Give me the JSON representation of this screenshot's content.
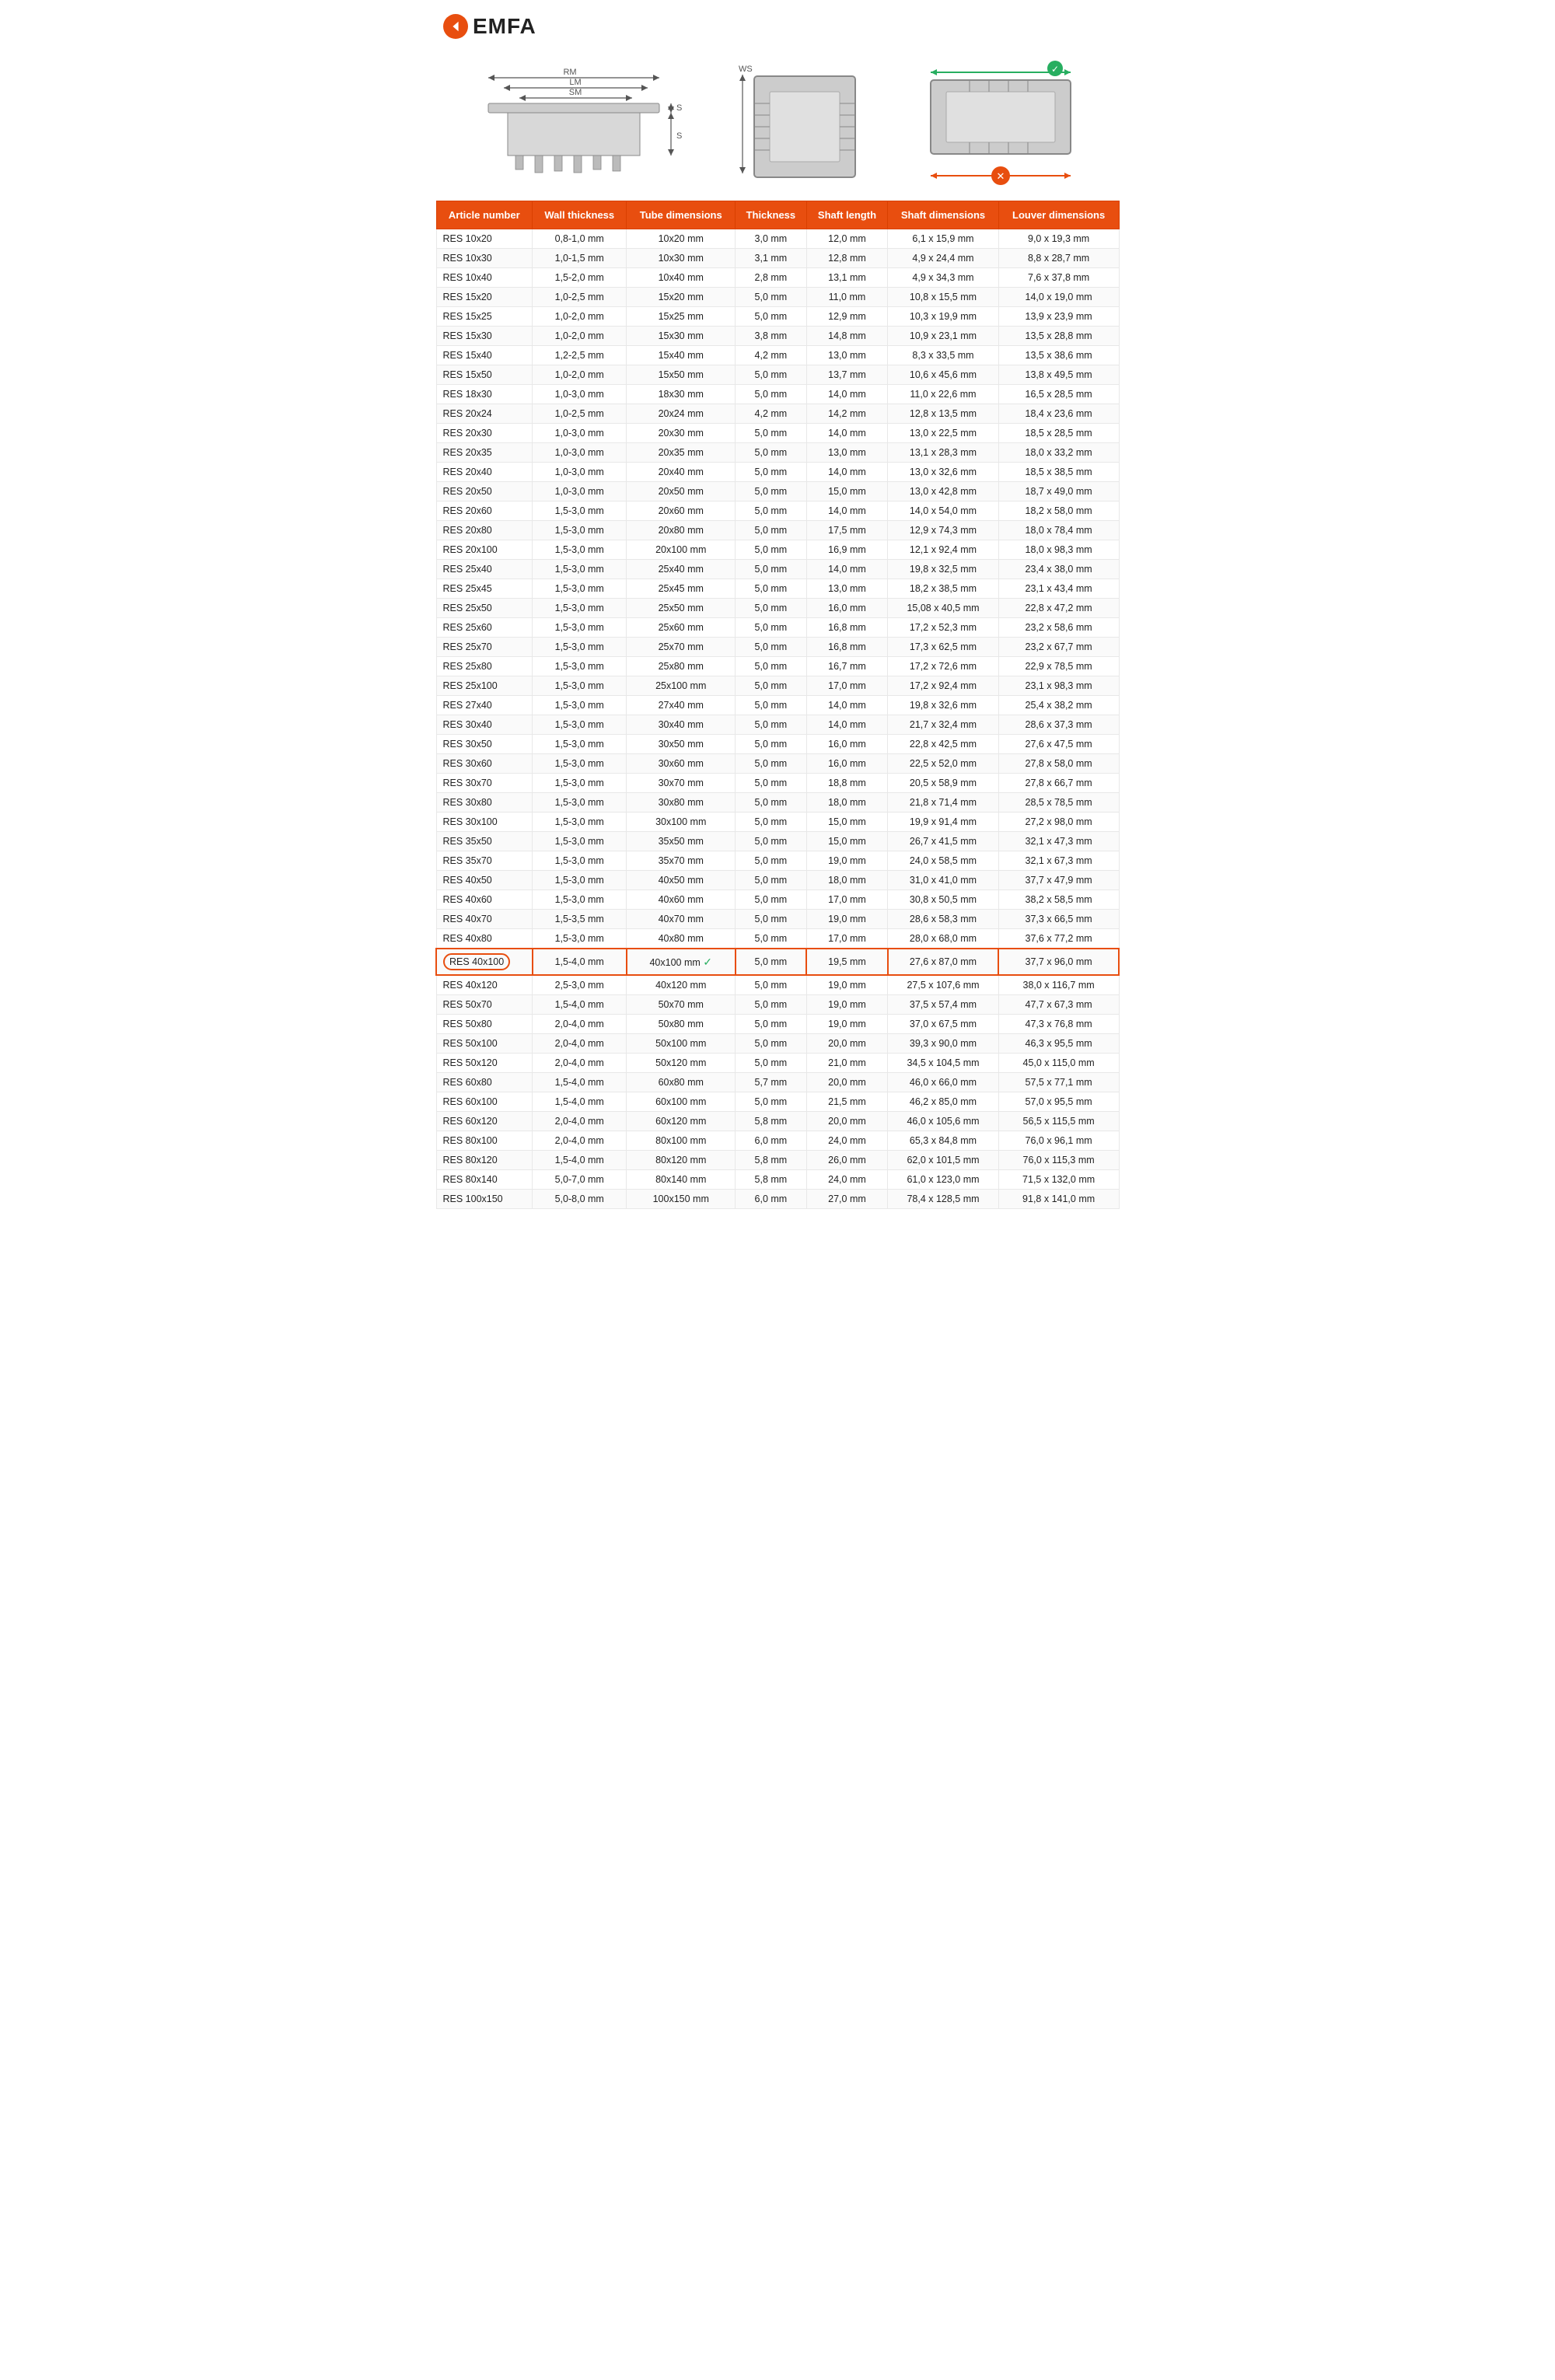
{
  "logo": {
    "brand": "EMFA",
    "icon": "◀"
  },
  "diagrams": {
    "left": {
      "labels": [
        "RM",
        "LM",
        "SM",
        "SK",
        "SE"
      ]
    },
    "middle": {
      "labels": [
        "WS"
      ]
    },
    "right": {
      "ok_icon": "✓",
      "fail_icon": "✗"
    }
  },
  "table": {
    "headers": [
      "Article number",
      "Wall thickness",
      "Tube dimensions",
      "Thickness",
      "Shaft length",
      "Shaft dimensions",
      "Louver dimensions"
    ],
    "rows": [
      [
        "RES 10x20",
        "0,8-1,0 mm",
        "10x20 mm",
        "3,0 mm",
        "12,0 mm",
        "6,1 x 15,9 mm",
        "9,0 x 19,3 mm"
      ],
      [
        "RES 10x30",
        "1,0-1,5 mm",
        "10x30 mm",
        "3,1 mm",
        "12,8 mm",
        "4,9 x 24,4 mm",
        "8,8 x 28,7 mm"
      ],
      [
        "RES 10x40",
        "1,5-2,0 mm",
        "10x40 mm",
        "2,8 mm",
        "13,1 mm",
        "4,9 x 34,3 mm",
        "7,6 x 37,8 mm"
      ],
      [
        "RES 15x20",
        "1,0-2,5 mm",
        "15x20 mm",
        "5,0 mm",
        "11,0 mm",
        "10,8 x 15,5 mm",
        "14,0 x 19,0 mm"
      ],
      [
        "RES 15x25",
        "1,0-2,0 mm",
        "15x25 mm",
        "5,0 mm",
        "12,9 mm",
        "10,3 x 19,9 mm",
        "13,9 x 23,9 mm"
      ],
      [
        "RES 15x30",
        "1,0-2,0 mm",
        "15x30 mm",
        "3,8 mm",
        "14,8 mm",
        "10,9 x 23,1 mm",
        "13,5 x 28,8 mm"
      ],
      [
        "RES 15x40",
        "1,2-2,5 mm",
        "15x40 mm",
        "4,2 mm",
        "13,0 mm",
        "8,3 x 33,5 mm",
        "13,5 x 38,6 mm"
      ],
      [
        "RES 15x50",
        "1,0-2,0 mm",
        "15x50 mm",
        "5,0 mm",
        "13,7 mm",
        "10,6 x 45,6 mm",
        "13,8 x 49,5 mm"
      ],
      [
        "RES 18x30",
        "1,0-3,0 mm",
        "18x30 mm",
        "5,0 mm",
        "14,0 mm",
        "11,0 x 22,6 mm",
        "16,5 x 28,5 mm"
      ],
      [
        "RES 20x24",
        "1,0-2,5 mm",
        "20x24 mm",
        "4,2 mm",
        "14,2 mm",
        "12,8 x 13,5 mm",
        "18,4 x 23,6 mm"
      ],
      [
        "RES 20x30",
        "1,0-3,0 mm",
        "20x30 mm",
        "5,0 mm",
        "14,0 mm",
        "13,0 x 22,5 mm",
        "18,5 x 28,5 mm"
      ],
      [
        "RES 20x35",
        "1,0-3,0 mm",
        "20x35 mm",
        "5,0 mm",
        "13,0 mm",
        "13,1 x 28,3 mm",
        "18,0 x 33,2 mm"
      ],
      [
        "RES 20x40",
        "1,0-3,0 mm",
        "20x40 mm",
        "5,0 mm",
        "14,0 mm",
        "13,0 x 32,6 mm",
        "18,5 x 38,5 mm"
      ],
      [
        "RES 20x50",
        "1,0-3,0 mm",
        "20x50 mm",
        "5,0 mm",
        "15,0 mm",
        "13,0 x 42,8 mm",
        "18,7 x 49,0 mm"
      ],
      [
        "RES 20x60",
        "1,5-3,0 mm",
        "20x60 mm",
        "5,0 mm",
        "14,0 mm",
        "14,0 x 54,0 mm",
        "18,2 x 58,0 mm"
      ],
      [
        "RES 20x80",
        "1,5-3,0 mm",
        "20x80 mm",
        "5,0 mm",
        "17,5 mm",
        "12,9 x 74,3 mm",
        "18,0 x 78,4 mm"
      ],
      [
        "RES 20x100",
        "1,5-3,0 mm",
        "20x100 mm",
        "5,0 mm",
        "16,9 mm",
        "12,1 x 92,4 mm",
        "18,0 x 98,3 mm"
      ],
      [
        "RES 25x40",
        "1,5-3,0 mm",
        "25x40 mm",
        "5,0 mm",
        "14,0 mm",
        "19,8 x 32,5 mm",
        "23,4 x 38,0 mm"
      ],
      [
        "RES 25x45",
        "1,5-3,0 mm",
        "25x45 mm",
        "5,0 mm",
        "13,0 mm",
        "18,2 x 38,5 mm",
        "23,1 x 43,4 mm"
      ],
      [
        "RES 25x50",
        "1,5-3,0 mm",
        "25x50 mm",
        "5,0 mm",
        "16,0 mm",
        "15,08 x 40,5 mm",
        "22,8 x 47,2 mm"
      ],
      [
        "RES 25x60",
        "1,5-3,0 mm",
        "25x60 mm",
        "5,0 mm",
        "16,8 mm",
        "17,2 x 52,3 mm",
        "23,2 x 58,6 mm"
      ],
      [
        "RES 25x70",
        "1,5-3,0 mm",
        "25x70 mm",
        "5,0 mm",
        "16,8 mm",
        "17,3 x 62,5 mm",
        "23,2 x 67,7 mm"
      ],
      [
        "RES 25x80",
        "1,5-3,0 mm",
        "25x80 mm",
        "5,0 mm",
        "16,7 mm",
        "17,2 x 72,6 mm",
        "22,9 x 78,5 mm"
      ],
      [
        "RES 25x100",
        "1,5-3,0 mm",
        "25x100 mm",
        "5,0 mm",
        "17,0 mm",
        "17,2 x 92,4 mm",
        "23,1 x 98,3 mm"
      ],
      [
        "RES 27x40",
        "1,5-3,0 mm",
        "27x40 mm",
        "5,0 mm",
        "14,0 mm",
        "19,8 x 32,6 mm",
        "25,4 x 38,2 mm"
      ],
      [
        "RES 30x40",
        "1,5-3,0 mm",
        "30x40 mm",
        "5,0 mm",
        "14,0 mm",
        "21,7 x 32,4 mm",
        "28,6 x 37,3 mm"
      ],
      [
        "RES 30x50",
        "1,5-3,0 mm",
        "30x50 mm",
        "5,0 mm",
        "16,0 mm",
        "22,8 x 42,5 mm",
        "27,6 x 47,5 mm"
      ],
      [
        "RES 30x60",
        "1,5-3,0 mm",
        "30x60 mm",
        "5,0 mm",
        "16,0 mm",
        "22,5 x 52,0 mm",
        "27,8 x 58,0 mm"
      ],
      [
        "RES 30x70",
        "1,5-3,0 mm",
        "30x70 mm",
        "5,0 mm",
        "18,8 mm",
        "20,5 x 58,9 mm",
        "27,8 x 66,7 mm"
      ],
      [
        "RES 30x80",
        "1,5-3,0 mm",
        "30x80 mm",
        "5,0 mm",
        "18,0 mm",
        "21,8 x 71,4 mm",
        "28,5 x 78,5 mm"
      ],
      [
        "RES 30x100",
        "1,5-3,0 mm",
        "30x100 mm",
        "5,0 mm",
        "15,0 mm",
        "19,9 x 91,4 mm",
        "27,2 x 98,0 mm"
      ],
      [
        "RES 35x50",
        "1,5-3,0 mm",
        "35x50 mm",
        "5,0 mm",
        "15,0 mm",
        "26,7 x 41,5 mm",
        "32,1 x 47,3 mm"
      ],
      [
        "RES 35x70",
        "1,5-3,0 mm",
        "35x70 mm",
        "5,0 mm",
        "19,0 mm",
        "24,0 x 58,5 mm",
        "32,1 x 67,3 mm"
      ],
      [
        "RES 40x50",
        "1,5-3,0 mm",
        "40x50 mm",
        "5,0 mm",
        "18,0 mm",
        "31,0 x 41,0 mm",
        "37,7 x 47,9 mm"
      ],
      [
        "RES 40x60",
        "1,5-3,0 mm",
        "40x60 mm",
        "5,0 mm",
        "17,0 mm",
        "30,8 x 50,5 mm",
        "38,2 x 58,5 mm"
      ],
      [
        "RES 40x70",
        "1,5-3,5 mm",
        "40x70 mm",
        "5,0 mm",
        "19,0 mm",
        "28,6 x 58,3 mm",
        "37,3 x 66,5 mm"
      ],
      [
        "RES 40x80",
        "1,5-3,0 mm",
        "40x80 mm",
        "5,0 mm",
        "17,0 mm",
        "28,0 x 68,0 mm",
        "37,6 x 77,2 mm"
      ],
      [
        "RES 40x100",
        "1,5-4,0 mm",
        "40x100 mm",
        "5,0 mm",
        "19,5 mm",
        "27,6 x 87,0 mm",
        "37,7 x 96,0 mm",
        true
      ],
      [
        "RES 40x120",
        "2,5-3,0 mm",
        "40x120 mm",
        "5,0 mm",
        "19,0 mm",
        "27,5 x 107,6 mm",
        "38,0 x 116,7 mm"
      ],
      [
        "RES 50x70",
        "1,5-4,0 mm",
        "50x70 mm",
        "5,0 mm",
        "19,0 mm",
        "37,5 x 57,4 mm",
        "47,7 x 67,3 mm"
      ],
      [
        "RES 50x80",
        "2,0-4,0 mm",
        "50x80 mm",
        "5,0 mm",
        "19,0 mm",
        "37,0 x 67,5 mm",
        "47,3 x 76,8 mm"
      ],
      [
        "RES 50x100",
        "2,0-4,0 mm",
        "50x100 mm",
        "5,0 mm",
        "20,0 mm",
        "39,3 x 90,0 mm",
        "46,3 x 95,5 mm"
      ],
      [
        "RES 50x120",
        "2,0-4,0 mm",
        "50x120 mm",
        "5,0 mm",
        "21,0 mm",
        "34,5 x 104,5 mm",
        "45,0 x 115,0 mm"
      ],
      [
        "RES 60x80",
        "1,5-4,0 mm",
        "60x80 mm",
        "5,7 mm",
        "20,0 mm",
        "46,0 x 66,0 mm",
        "57,5 x 77,1 mm"
      ],
      [
        "RES 60x100",
        "1,5-4,0 mm",
        "60x100 mm",
        "5,0 mm",
        "21,5 mm",
        "46,2 x 85,0 mm",
        "57,0 x 95,5 mm"
      ],
      [
        "RES 60x120",
        "2,0-4,0 mm",
        "60x120 mm",
        "5,8 mm",
        "20,0 mm",
        "46,0 x 105,6 mm",
        "56,5 x 115,5 mm"
      ],
      [
        "RES 80x100",
        "2,0-4,0 mm",
        "80x100 mm",
        "6,0 mm",
        "24,0 mm",
        "65,3 x 84,8 mm",
        "76,0 x 96,1 mm"
      ],
      [
        "RES 80x120",
        "1,5-4,0 mm",
        "80x120 mm",
        "5,8 mm",
        "26,0 mm",
        "62,0 x 101,5 mm",
        "76,0 x 115,3 mm"
      ],
      [
        "RES 80x140",
        "5,0-7,0 mm",
        "80x140 mm",
        "5,8 mm",
        "24,0 mm",
        "61,0 x 123,0 mm",
        "71,5 x 132,0 mm"
      ],
      [
        "RES 100x150",
        "5,0-8,0 mm",
        "100x150 mm",
        "6,0 mm",
        "27,0 mm",
        "78,4 x 128,5 mm",
        "91,8 x 141,0 mm"
      ]
    ]
  },
  "colors": {
    "brand_orange": "#e84e0f",
    "green": "#27ae60",
    "header_bg": "#e84e0f"
  }
}
